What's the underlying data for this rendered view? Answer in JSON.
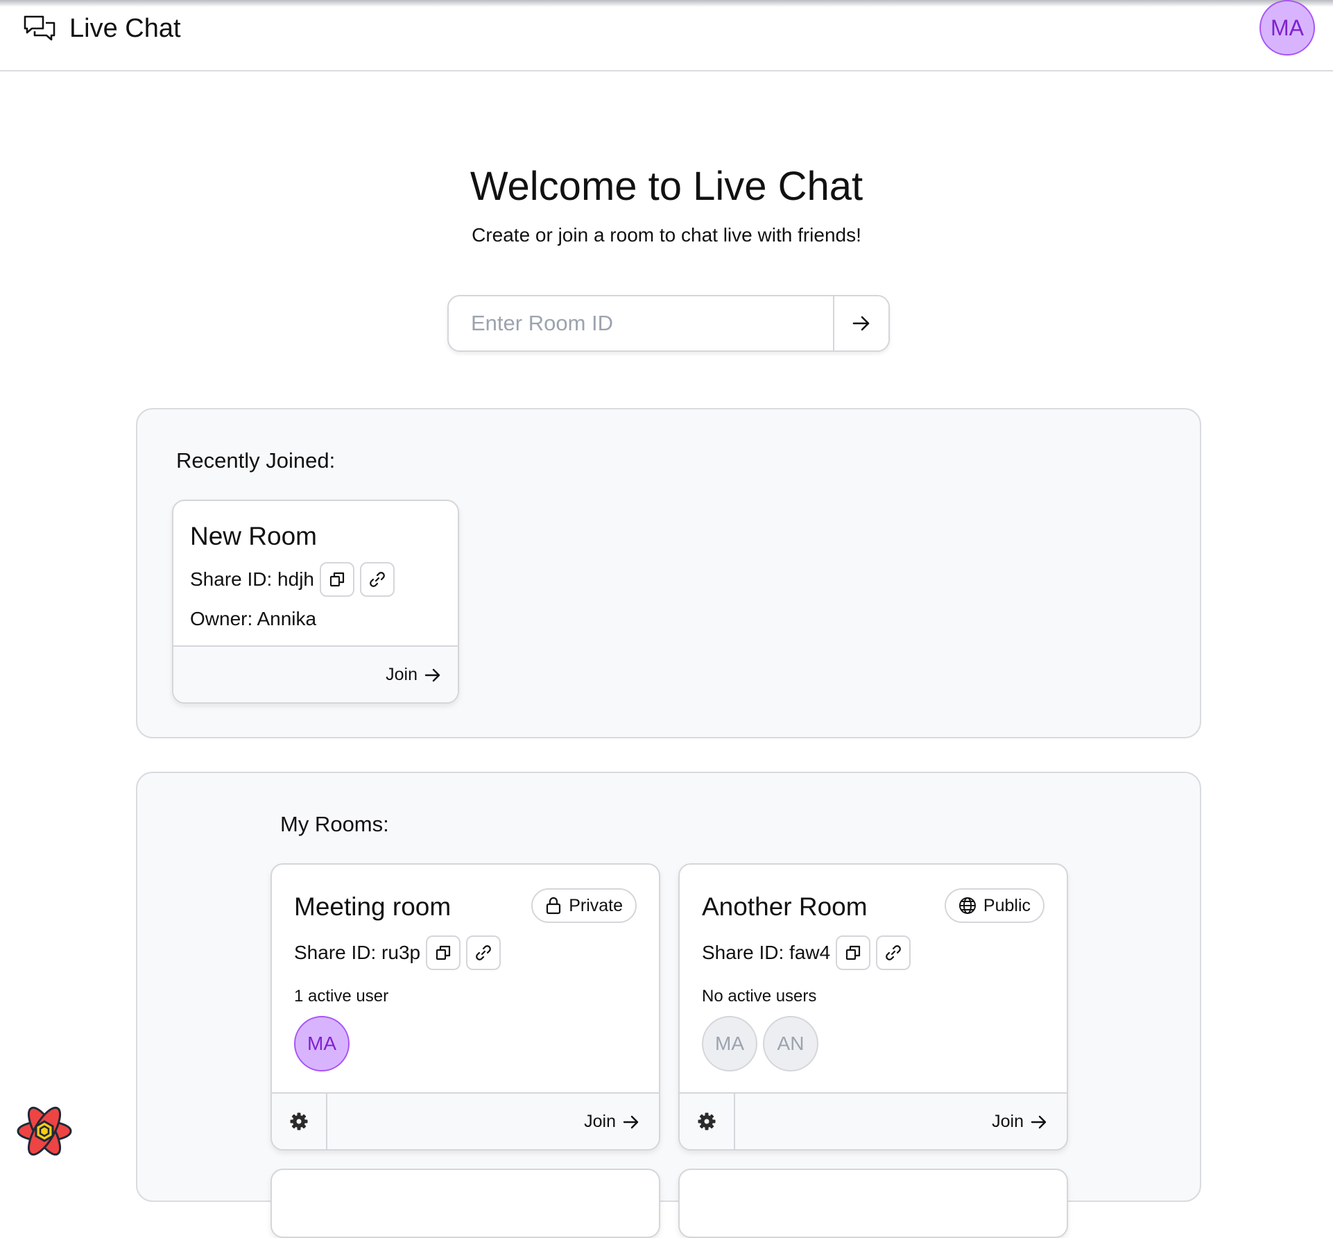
{
  "app": {
    "title": "Live Chat",
    "user_initials": "MA"
  },
  "hero": {
    "title": "Welcome to Live Chat",
    "subtitle": "Create or join a room to chat live with friends!"
  },
  "room_input": {
    "placeholder": "Enter Room ID",
    "value": ""
  },
  "recent": {
    "title": "Recently Joined:",
    "rooms": [
      {
        "name": "New Room",
        "share_label": "Share ID: hdjh",
        "owner_label": "Owner: Annika",
        "join_label": "Join"
      }
    ]
  },
  "my_rooms": {
    "title": "My Rooms:",
    "rooms": [
      {
        "name": "Meeting room",
        "visibility": "Private",
        "share_label": "Share ID: ru3p",
        "users_label": "1 active user",
        "avatars": [
          "MA"
        ],
        "join_label": "Join"
      },
      {
        "name": "Another Room",
        "visibility": "Public",
        "share_label": "Share ID: faw4",
        "users_label": "No active users",
        "avatars": [
          "MA",
          "AN"
        ],
        "join_label": "Join"
      }
    ]
  },
  "colors": {
    "accent_purple": "#a855f7",
    "avatar_active_bg": "#d8b4fe",
    "panel_bg": "#f8f9fb",
    "border": "#d4d6da"
  }
}
